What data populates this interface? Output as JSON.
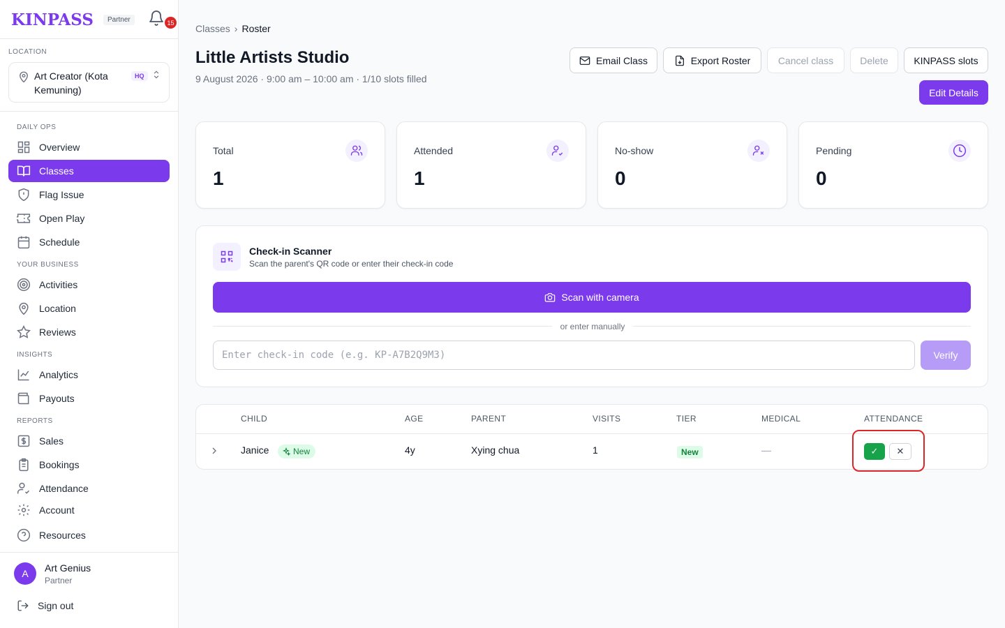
{
  "brand": {
    "logo": "KINPASS",
    "partner_tag": "Partner",
    "notifications": "15"
  },
  "location": {
    "label": "LOCATION",
    "name": "Art Creator (Kota Kemuning)",
    "badge": "HQ"
  },
  "sidebar": {
    "sections": [
      "DAILY OPS",
      "YOUR BUSINESS",
      "INSIGHTS",
      "REPORTS"
    ],
    "items": [
      {
        "label": "Overview",
        "icon": "grid-icon"
      },
      {
        "label": "Classes",
        "icon": "book-icon",
        "active": true
      },
      {
        "label": "Flag Issue",
        "icon": "shield-alert-icon"
      },
      {
        "label": "Open Play",
        "icon": "ticket-icon"
      },
      {
        "label": "Schedule",
        "icon": "calendar-icon"
      },
      {
        "label": "Activities",
        "icon": "target-icon"
      },
      {
        "label": "Location",
        "icon": "map-pin-icon"
      },
      {
        "label": "Reviews",
        "icon": "star-icon"
      },
      {
        "label": "Analytics",
        "icon": "line-chart-icon"
      },
      {
        "label": "Payouts",
        "icon": "wallet-icon"
      },
      {
        "label": "Sales",
        "icon": "dollar-icon"
      },
      {
        "label": "Bookings",
        "icon": "clipboard-icon"
      },
      {
        "label": "Attendance",
        "icon": "user-check-icon"
      },
      {
        "label": "Account",
        "icon": "gear-icon"
      },
      {
        "label": "Resources",
        "icon": "help-circle-icon"
      }
    ]
  },
  "user": {
    "initial": "A",
    "name": "Art Genius",
    "role": "Partner",
    "sign_out": "Sign out"
  },
  "breadcrumb": {
    "parent": "Classes",
    "current": "Roster",
    "separator": "›"
  },
  "header": {
    "title": "Little Artists Studio",
    "subtitle": "9 August 2026 · 9:00 am – 10:00 am · 1/10 slots filled",
    "buttons": {
      "email": "Email Class",
      "export": "Export Roster",
      "cancel": "Cancel class",
      "delete": "Delete",
      "slots": "KINPASS slots",
      "edit": "Edit Details"
    }
  },
  "stats": [
    {
      "label": "Total",
      "value": "1",
      "icon": "users-icon"
    },
    {
      "label": "Attended",
      "value": "1",
      "icon": "user-check-icon"
    },
    {
      "label": "No-show",
      "value": "0",
      "icon": "user-x-icon"
    },
    {
      "label": "Pending",
      "value": "0",
      "icon": "clock-icon"
    }
  ],
  "scanner": {
    "title": "Check-in Scanner",
    "subtitle": "Scan the parent's QR code or enter their check-in code",
    "scan_button": "Scan with camera",
    "divider": "or enter manually",
    "input_placeholder": "Enter check-in code (e.g. KP-A7B2Q9M3)",
    "input_value": "",
    "verify": "Verify"
  },
  "table": {
    "headers": [
      "CHILD",
      "AGE",
      "PARENT",
      "VISITS",
      "TIER",
      "MEDICAL",
      "ATTENDANCE"
    ],
    "rows": [
      {
        "child": "Janice",
        "child_badge": "New",
        "age": "4y",
        "parent": "Xying chua",
        "visits": "1",
        "tier": "New",
        "medical": "—",
        "attend_yes": "✓",
        "attend_no": "✕"
      }
    ]
  },
  "colors": {
    "accent": "#7c3aed",
    "success": "#16a34a",
    "danger": "#dc2626"
  }
}
